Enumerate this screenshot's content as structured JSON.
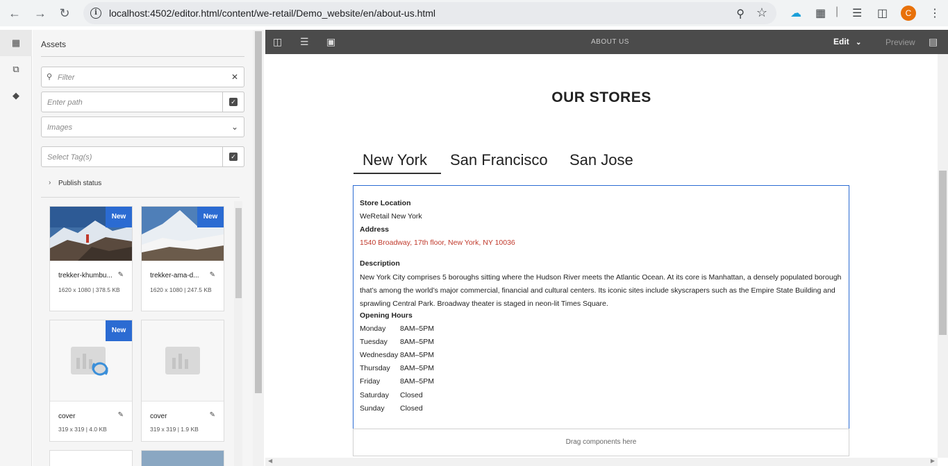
{
  "browser": {
    "url": "localhost:4502/editor.html/content/we-retail/Demo_website/en/about-us.html",
    "avatar_letter": "C"
  },
  "assets_panel": {
    "title": "Assets",
    "filter_placeholder": "Filter",
    "path_placeholder": "Enter path",
    "type_select_value": "Images",
    "tags_placeholder": "Select Tag(s)",
    "publish_status_label": "Publish status",
    "cards": [
      {
        "name": "trekker-khumbu...",
        "meta": "1620 x 1080 | 378.5 KB",
        "badge": "New"
      },
      {
        "name": "trekker-ama-d...",
        "meta": "1620 x 1080 | 247.5 KB",
        "badge": "New"
      },
      {
        "name": "cover",
        "meta": "319 x 319 | 4.0 KB",
        "badge": "New"
      },
      {
        "name": "cover",
        "meta": "319 x 319 | 1.9 KB",
        "badge": ""
      }
    ]
  },
  "editor": {
    "page_title": "ABOUT US",
    "mode_label": "Edit",
    "preview_label": "Preview"
  },
  "page": {
    "heading": "OUR STORES",
    "tabs": [
      "New York",
      "San Francisco",
      "San Jose"
    ],
    "store": {
      "location_label": "Store Location",
      "location_value": "WeRetail New York",
      "address_label": "Address",
      "address_value": "1540 Broadway, 17th floor, New York, NY 10036",
      "description_label": "Description",
      "description_value": "New York City comprises 5 boroughs sitting where the Hudson River meets the Atlantic Ocean. At its core is Manhattan, a densely populated borough that’s among the world’s major commercial, financial and cultural centers. Its iconic sites include skyscrapers such as the Empire State Building and sprawling Central Park. Broadway theater is staged in neon-lit Times Square.",
      "hours_label": "Opening Hours",
      "hours": [
        {
          "day": "Monday",
          "time": "8AM–5PM"
        },
        {
          "day": "Tuesday",
          "time": "8AM–5PM"
        },
        {
          "day": "Wednesday",
          "time": "8AM–5PM"
        },
        {
          "day": "Thursday",
          "time": "8AM–5PM"
        },
        {
          "day": "Friday",
          "time": "8AM–5PM"
        },
        {
          "day": "Saturday",
          "time": "Closed"
        },
        {
          "day": "Sunday",
          "time": "Closed"
        }
      ]
    },
    "drag_label": "Drag components here"
  },
  "colors": {
    "accent": "#2b6bd2",
    "address_red": "#c0392b",
    "editor_bar": "#4b4b4b"
  }
}
